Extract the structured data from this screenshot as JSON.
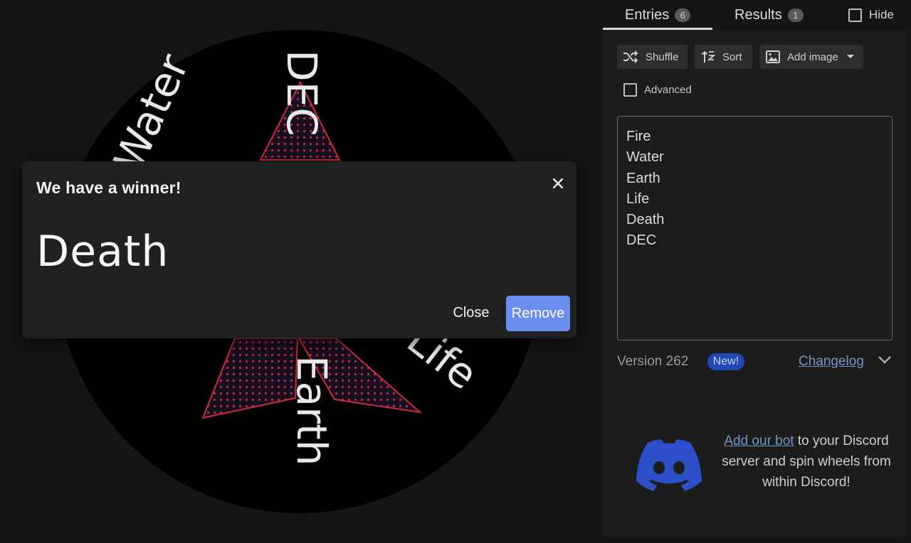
{
  "wheel": {
    "segments": [
      "Fire",
      "Water",
      "Earth",
      "Life",
      "Death",
      "DEC"
    ],
    "visible_labels": [
      "DEC",
      "Water",
      "Earth",
      "Life"
    ]
  },
  "dialog": {
    "title": "We have a winner!",
    "winner": "Death",
    "close_label": "Close",
    "remove_label": "Remove",
    "accent_color": "#6a8ef0"
  },
  "tabs": [
    {
      "label": "Entries",
      "count": "6",
      "active": true
    },
    {
      "label": "Results",
      "count": "1",
      "active": false
    }
  ],
  "hide_label": "Hide",
  "toolbar": {
    "shuffle_label": "Shuffle",
    "sort_label": "Sort",
    "add_image_label": "Add image"
  },
  "advanced_label": "Advanced",
  "entries": [
    "Fire",
    "Water",
    "Earth",
    "Life",
    "Death",
    "DEC"
  ],
  "version": {
    "label": "Version 262",
    "badge": "New!",
    "changelog": "Changelog"
  },
  "discord": {
    "link_text": "Add our bot",
    "text_rest": " to your Discord server and spin wheels from within Discord!",
    "brand_color": "#2c4ec8"
  }
}
